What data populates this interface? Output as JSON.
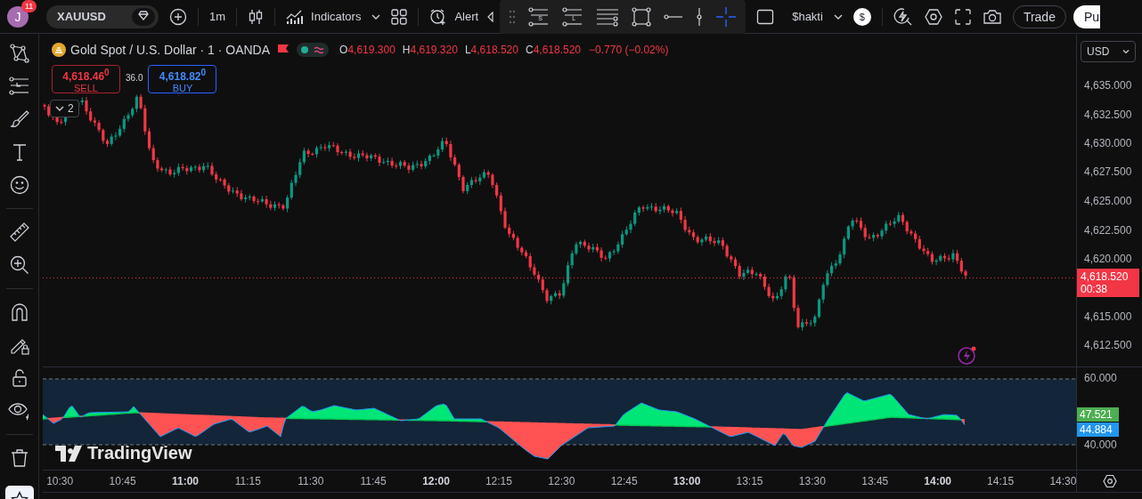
{
  "header": {
    "avatar": {
      "initial": "J",
      "badge": "11"
    },
    "symbol": "XAUUSD",
    "interval": "1m",
    "indicators": "Indicators",
    "alert": "Alert",
    "layout_name": "$hakti",
    "currency": "$",
    "trade": "Trade",
    "publish": "Pu"
  },
  "drawing_tools": [
    {
      "kind": "grip"
    },
    {
      "kind": "lines",
      "letter": "S"
    },
    {
      "kind": "lines",
      "letter": "L"
    },
    {
      "kind": "multiline"
    },
    {
      "kind": "rectangle"
    },
    {
      "kind": "hline"
    },
    {
      "kind": "vline"
    },
    {
      "kind": "crosshair"
    }
  ],
  "legend": {
    "title": "Gold Spot / U.S. Dollar · 1 · OANDA",
    "ohlc": [
      {
        "label": "O",
        "value": "4,619.300"
      },
      {
        "label": "H",
        "value": "4,619.320"
      },
      {
        "label": "L",
        "value": "4,618.520"
      },
      {
        "label": "C",
        "value": "4,618.520"
      }
    ],
    "change": "−0.770 (−0.02%)"
  },
  "trade_buttons": {
    "sell": {
      "price": "4,618.46$^{0}$",
      "label": "SELL"
    },
    "spread": "36.0",
    "buy": {
      "price": "4,618.82$^{0}$",
      "label": "BUY"
    }
  },
  "indicators_collapsed": "2",
  "price_axis": {
    "currency": "USD",
    "ticks": [
      "4,635.000",
      "4,632.500",
      "4,630.000",
      "4,627.500",
      "4,625.000",
      "4,622.500",
      "4,620.000",
      "4,615.000",
      "4,612.500"
    ],
    "last_price": "4,618.520",
    "countdown": "00:38"
  },
  "oscillator_axis": {
    "ticks": [
      "60.000",
      "40.000"
    ],
    "labels": [
      {
        "value": "47.521",
        "color": "#4caf50"
      },
      {
        "value": "44.884",
        "color": "#2196f3"
      }
    ]
  },
  "watermark": "TradingView",
  "time_axis": [
    {
      "label": "10:30",
      "kind": "minute"
    },
    {
      "label": "10:45",
      "kind": "minute"
    },
    {
      "label": "11:00",
      "kind": "hour"
    },
    {
      "label": "11:15",
      "kind": "minute"
    },
    {
      "label": "11:30",
      "kind": "minute"
    },
    {
      "label": "11:45",
      "kind": "minute"
    },
    {
      "label": "12:00",
      "kind": "hour"
    },
    {
      "label": "12:15",
      "kind": "minute"
    },
    {
      "label": "12:30",
      "kind": "minute"
    },
    {
      "label": "12:45",
      "kind": "minute"
    },
    {
      "label": "13:00",
      "kind": "hour"
    },
    {
      "label": "13:15",
      "kind": "minute"
    },
    {
      "label": "13:30",
      "kind": "minute"
    },
    {
      "label": "13:45",
      "kind": "minute"
    },
    {
      "label": "14:00",
      "kind": "hour"
    },
    {
      "label": "14:15",
      "kind": "minute"
    },
    {
      "label": "14:30",
      "kind": "minute"
    }
  ]
}
